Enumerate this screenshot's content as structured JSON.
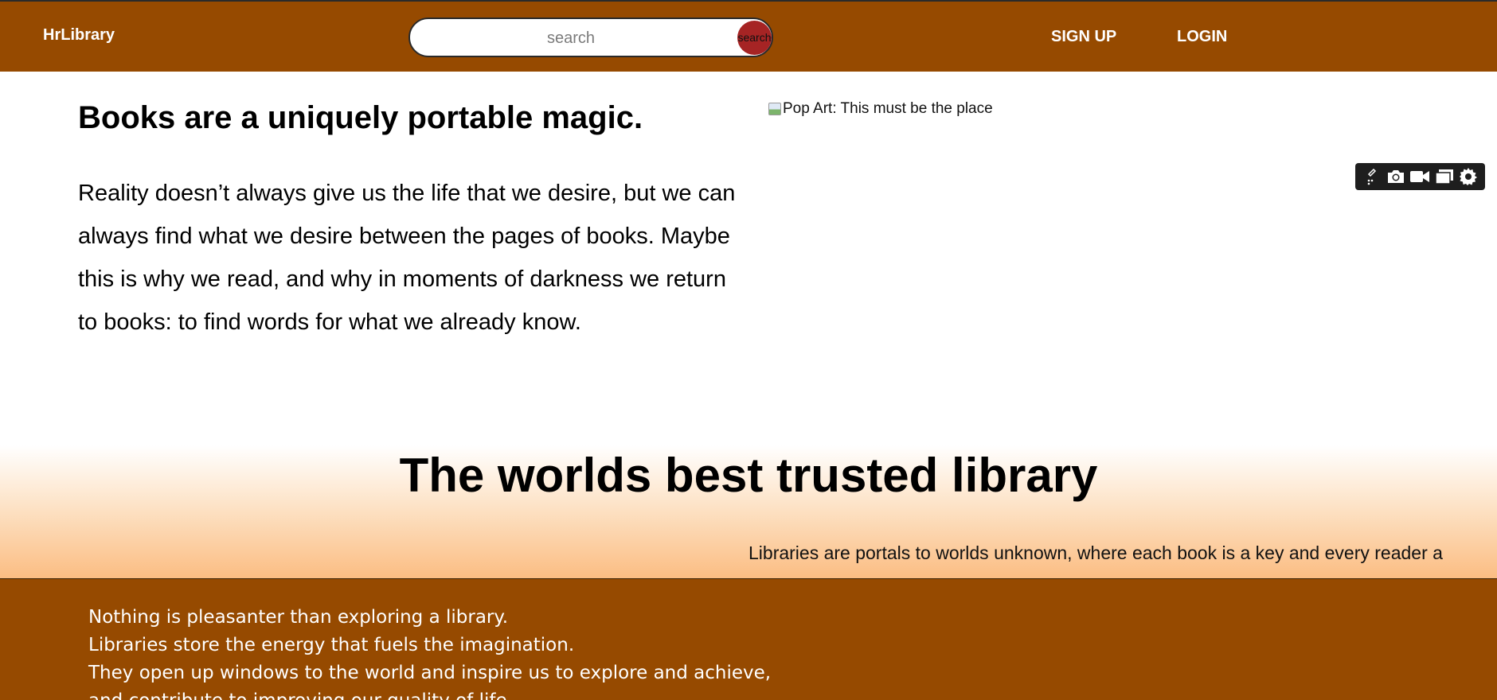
{
  "navbar": {
    "brand": "HrLibrary",
    "search": {
      "placeholder": "search",
      "button_label": "search"
    },
    "links": {
      "signup": "SIGN UP",
      "login": "LOGIN"
    }
  },
  "hero": {
    "heading": "Books are a uniquely portable magic.",
    "paragraph": "Reality doesn’t always give us the life that we desire, but we can always find what we desire between the pages of books. Maybe this is why we read, and why in moments of darkness we return to books: to find words for what we already know.",
    "image_alt": "Pop Art: This must be the place"
  },
  "toolbar": {
    "icons": [
      "edit-icon",
      "camera-icon",
      "video-icon",
      "window-icon",
      "gear-icon"
    ]
  },
  "trusted": {
    "title": "The worlds best trusted library",
    "marquee": "Libraries are portals to worlds unknown, where each book is a key and every reader a"
  },
  "quotes": [
    "Nothing is pleasanter than exploring a library.",
    "Libraries store the energy that fuels the imagination.",
    "They open up windows to the world and inspire us to explore and achieve,",
    "and contribute to improving our quality of life."
  ],
  "colors": {
    "nav_bg": "#964a00",
    "search_button": "#a62424",
    "band_gradient_end": "#fbbd82"
  }
}
